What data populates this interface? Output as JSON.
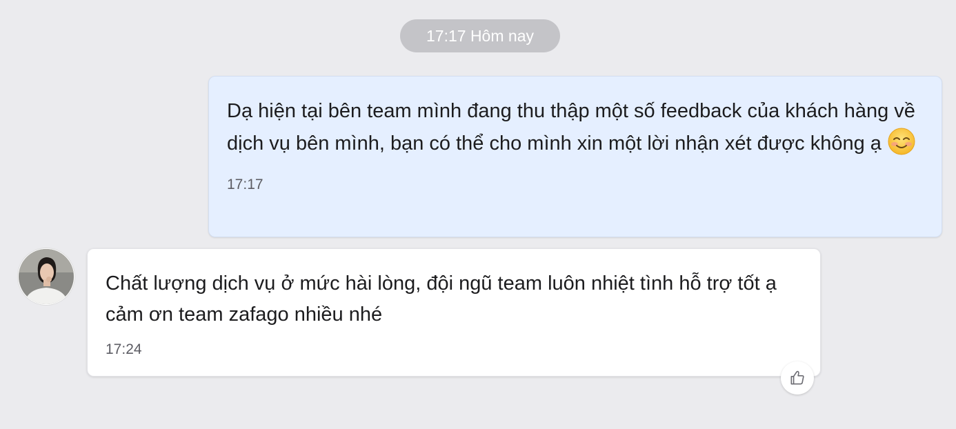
{
  "date_divider": "17:17 Hôm nay",
  "messages": [
    {
      "direction": "outgoing",
      "text": "Dạ hiện tại bên team mình đang thu thập một số feedback của khách hàng về dịch vụ bên mình, bạn có thể cho mình xin một lời nhận xét được không ạ",
      "emoji": "blushing-smile-icon",
      "time": "17:17"
    },
    {
      "direction": "incoming",
      "text": "Chất lượng dịch vụ ở mức hài lòng, đội ngũ team luôn nhiệt tình hỗ trợ tốt ạ cảm ơn team zafago nhiều nhé",
      "time": "17:24",
      "reaction_icon": "thumbs-up-icon"
    }
  ],
  "colors": {
    "background": "#ebebee",
    "outgoing_bubble": "#e5efff",
    "incoming_bubble": "#ffffff",
    "date_pill": "#c4c4c8"
  }
}
